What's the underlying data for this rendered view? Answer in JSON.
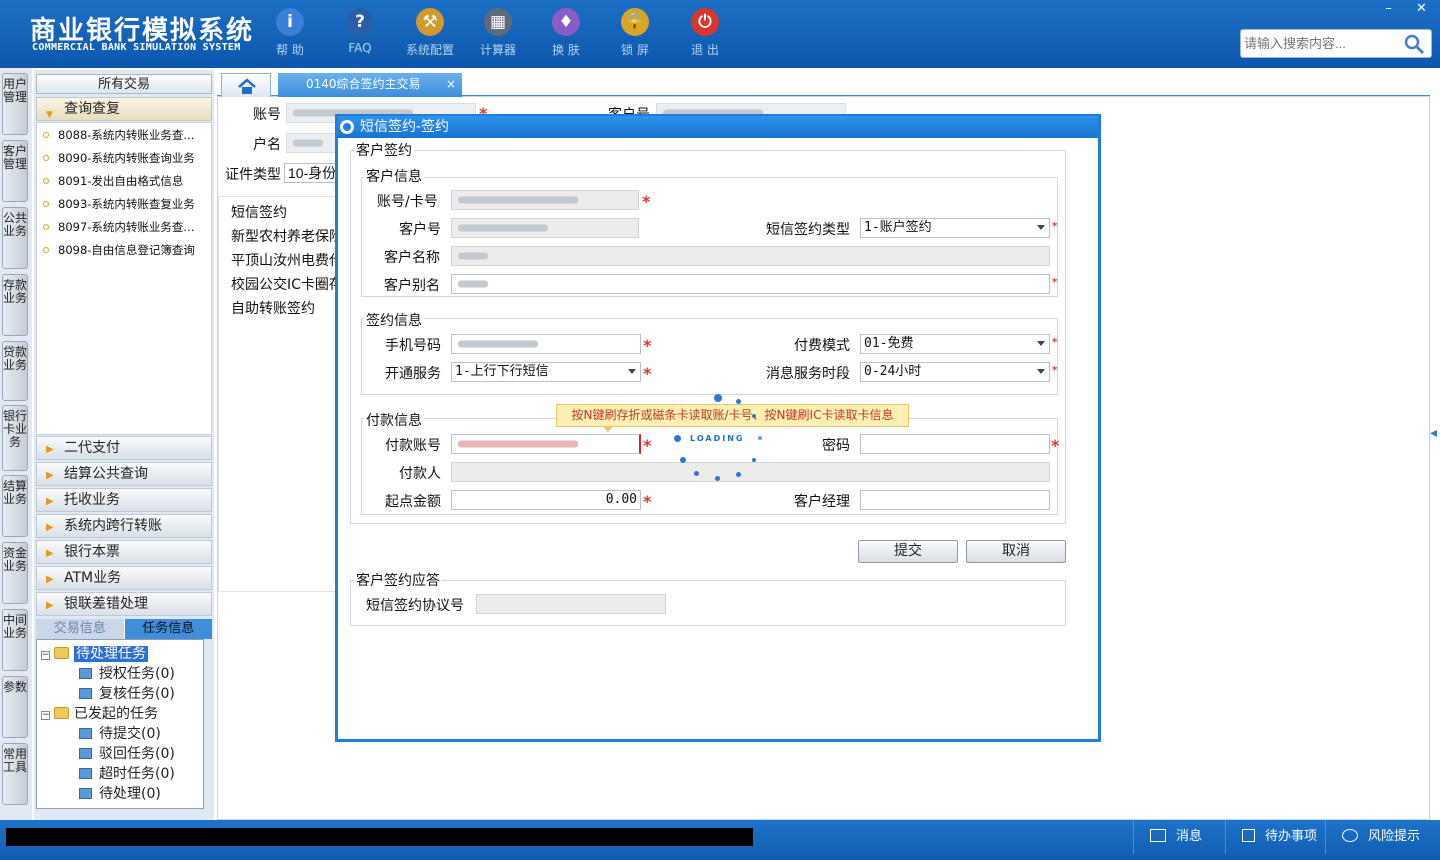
{
  "app": {
    "title_cn": "商业银行模拟系统",
    "title_en": "COMMERCIAL BANK SIMULATION SYSTEM"
  },
  "toolbar": [
    {
      "label": "帮 助",
      "icon": "info-icon",
      "glyph": "i",
      "color": "#3b7fd8"
    },
    {
      "label": "FAQ",
      "icon": "faq-icon",
      "glyph": "?",
      "color": "#2a5ea8"
    },
    {
      "label": "系统配置",
      "icon": "toolbox-icon",
      "glyph": "⚒",
      "color": "#d19a2e"
    },
    {
      "label": "计算器",
      "icon": "calculator-icon",
      "glyph": "▦",
      "color": "#5f6b78"
    },
    {
      "label": "换 肤",
      "icon": "shirt-icon",
      "glyph": "♦",
      "color": "#8b5cc8"
    },
    {
      "label": "锁 屏",
      "icon": "lock-icon",
      "glyph": "🔒",
      "color": "#d8a42b"
    },
    {
      "label": "退 出",
      "icon": "power-icon",
      "glyph": "⏻",
      "color": "#d9362c"
    }
  ],
  "search": {
    "placeholder": "请输入搜索内容..."
  },
  "window_controls": {
    "minimize": "–",
    "close": "✕"
  },
  "vertical_tabs": [
    "用户管理",
    "客户管理",
    "公共业务",
    "存款业务",
    "贷款业务",
    "银行卡业务",
    "结算业务",
    "资金业务",
    "中间业务",
    "参数",
    "常用工具"
  ],
  "left_panel": {
    "header": "所有交易",
    "query_section": "查询查复",
    "query_items": [
      "8088-系统内转账业务查...",
      "8090-系统内转账查询业务",
      "8091-发出自由格式信息",
      "8093-系统内转账查复业务",
      "8097-系统内转账业务查...",
      "8098-自由信息登记簿查询"
    ],
    "sections": [
      "二代支付",
      "结算公共查询",
      "托收业务",
      "系统内跨行转账",
      "银行本票",
      "ATM业务",
      "银联差错处理"
    ],
    "tabs": [
      "交易信息",
      "任务信息"
    ],
    "tree": {
      "pending": "待处理任务",
      "pending_children": [
        "授权任务(0)",
        "复核任务(0)"
      ],
      "initiated": "已发起的任务",
      "initiated_children": [
        "待提交(0)",
        "驳回任务(0)",
        "超时任务(0)",
        "待处理(0)"
      ]
    }
  },
  "tabs": {
    "active": "0140综合签约主交易",
    "close": "×"
  },
  "background_form": {
    "account_label": "账号",
    "customer_no_label": "客户号",
    "name_label": "户名",
    "id_type_label": "证件类型",
    "id_type_value": "10-身份",
    "sign_items": [
      "短信签约",
      "新型农村养老保险",
      "平顶山汝州电费代",
      "校园公交IC卡圈存",
      "自助转账签约"
    ]
  },
  "dialog": {
    "title": "短信签约-签约",
    "outer_legend": "客户签约",
    "customer_info": {
      "legend": "客户信息",
      "account_label": "账号/卡号",
      "customer_no_label": "客户号",
      "sms_type_label": "短信签约类型",
      "sms_type_value": "1-账户签约",
      "customer_name_label": "客户名称",
      "customer_alias_label": "客户别名"
    },
    "sign_info": {
      "legend": "签约信息",
      "phone_label": "手机号码",
      "fee_mode_label": "付费模式",
      "fee_mode_value": "01-免费",
      "service_label": "开通服务",
      "service_value": "1-上行下行短信",
      "time_label": "消息服务时段",
      "time_value": "0-24小时"
    },
    "payment_info": {
      "legend": "付款信息",
      "pay_account_label": "付款账号",
      "password_label": "密码",
      "payer_label": "付款人",
      "start_amount_label": "起点金额",
      "start_amount_value": "0.00",
      "manager_label": "客户经理"
    },
    "tooltip": "按N键刷存折或磁条卡读取账/卡号、按N键刷IC卡读取卡信息",
    "loading": "LOADING",
    "submit": "提交",
    "cancel": "取消",
    "response": {
      "legend": "客户签约应答",
      "protocol_label": "短信签约协议号"
    },
    "required_mark": "*"
  },
  "statusbar": {
    "messages": "消息",
    "todo": "待办事项",
    "risk": "风险提示"
  }
}
